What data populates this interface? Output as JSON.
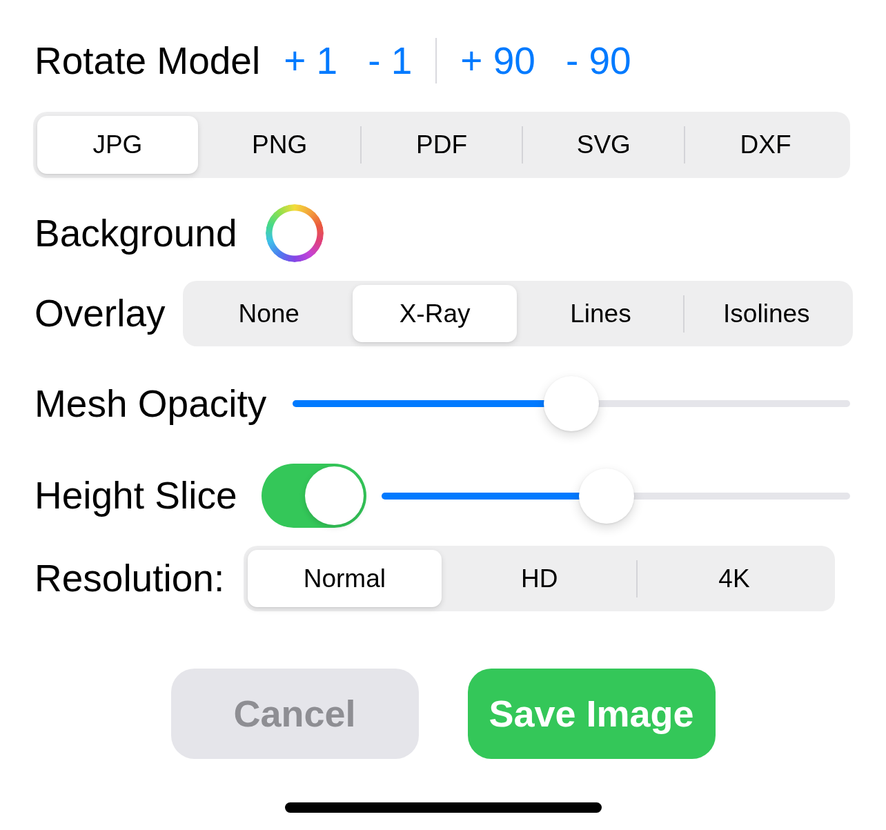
{
  "rotate_model": {
    "label": "Rotate Model",
    "groups": [
      {
        "buttons": [
          "+ 1",
          "- 1"
        ]
      },
      {
        "buttons": [
          "+ 90",
          "- 90"
        ]
      }
    ]
  },
  "format": {
    "segments": [
      {
        "label": "JPG",
        "selected": true
      },
      {
        "label": "PNG",
        "selected": false
      },
      {
        "label": "PDF",
        "selected": false
      },
      {
        "label": "SVG",
        "selected": false
      },
      {
        "label": "DXF",
        "selected": false
      }
    ]
  },
  "background": {
    "label": "Background"
  },
  "overlay": {
    "label": "Overlay",
    "segments": [
      {
        "label": "None",
        "selected": false
      },
      {
        "label": "X-Ray",
        "selected": true
      },
      {
        "label": "Lines",
        "selected": false
      },
      {
        "label": "Isolines",
        "selected": false
      }
    ]
  },
  "mesh_opacity": {
    "label": "Mesh Opacity",
    "level": 0.5
  },
  "height_slice": {
    "label": "Height Slice",
    "on": true,
    "level": 0.48
  },
  "resolution": {
    "label": "Resolution:",
    "segments": [
      {
        "label": "Normal",
        "selected": true
      },
      {
        "label": "HD",
        "selected": false
      },
      {
        "label": "4K",
        "selected": false
      }
    ]
  },
  "actions": [
    {
      "label": "Cancel",
      "kind": "secondary"
    },
    {
      "label": "Save Image",
      "kind": "primary"
    }
  ]
}
